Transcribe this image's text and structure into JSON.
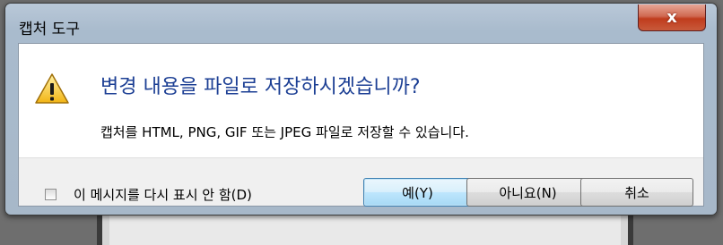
{
  "window": {
    "title": "캡처 도구",
    "close_glyph": "x"
  },
  "message": {
    "main_instruction": "변경 내용을 파일로 저장하시겠습니까?",
    "detail": "캡처를 HTML, PNG, GIF 또는 JPEG 파일로 저장할 수 있습니다."
  },
  "footer": {
    "checkbox_label": "이 메시지를 다시 표시 안 함(D)",
    "checkbox_checked": false,
    "buttons": {
      "yes": "예(Y)",
      "no": "아니요(N)",
      "cancel": "취소"
    }
  },
  "icons": {
    "warning": "warning-icon",
    "close": "close-icon"
  },
  "colors": {
    "instruction_text": "#1c3f94",
    "close_button": "#c03c1d",
    "title_bar": "#b9c8d8"
  }
}
